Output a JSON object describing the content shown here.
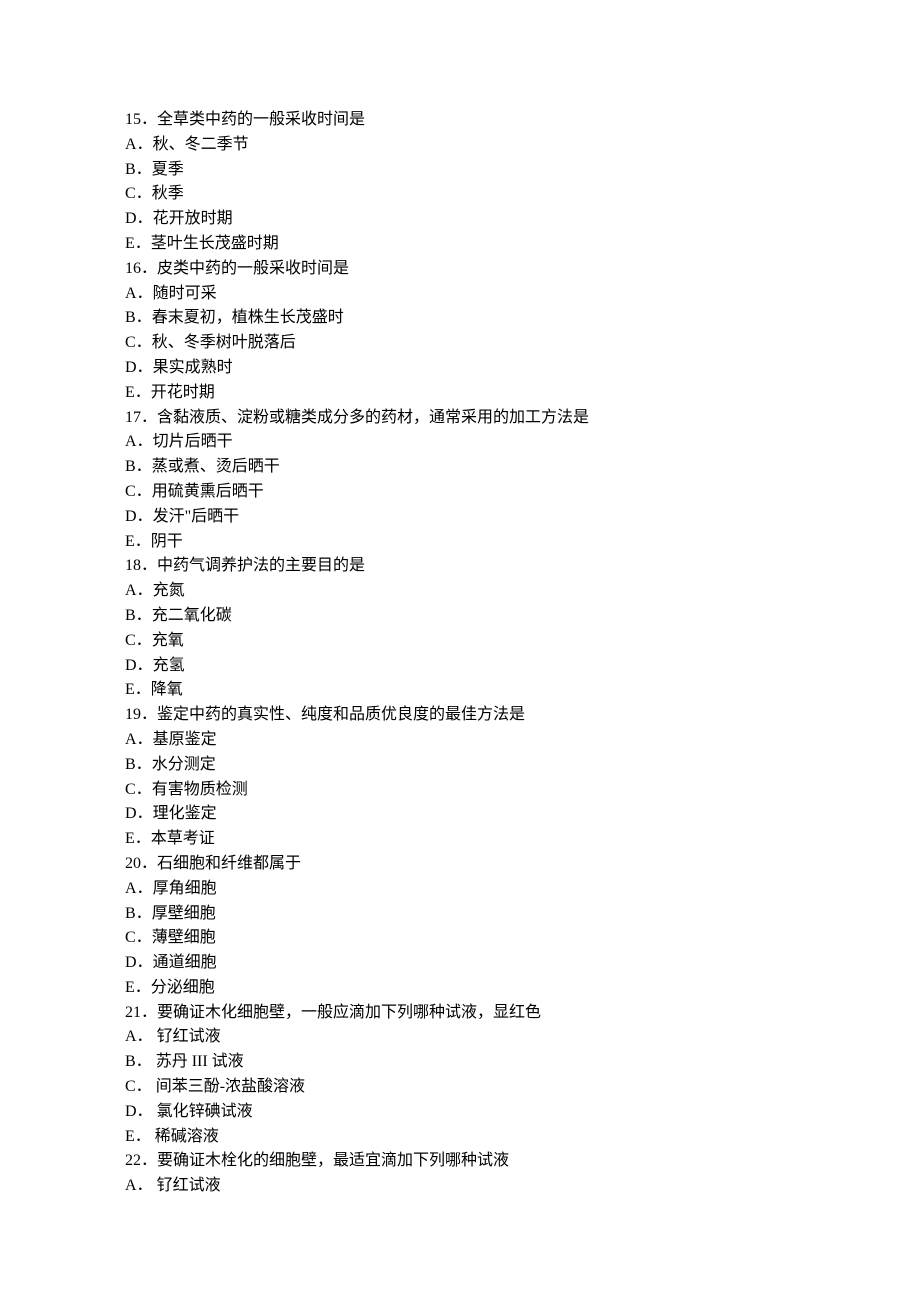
{
  "questions": [
    {
      "number": "15．",
      "stem": "全草类中药的一般采收时间是",
      "options": [
        {
          "letter": "A．",
          "text": "秋、冬二季节"
        },
        {
          "letter": "B．",
          "text": "夏季"
        },
        {
          "letter": "C．",
          "text": "秋季"
        },
        {
          "letter": "D．",
          "text": "花开放时期"
        },
        {
          "letter": "E．",
          "text": "茎叶生长茂盛时期"
        }
      ]
    },
    {
      "number": "16．",
      "stem": "皮类中药的一般采收时间是",
      "options": [
        {
          "letter": "A．",
          "text": "随时可采"
        },
        {
          "letter": "B．",
          "text": "春末夏初，植株生长茂盛时"
        },
        {
          "letter": "C．",
          "text": "秋、冬季树叶脱落后"
        },
        {
          "letter": "D．",
          "text": "果实成熟时"
        },
        {
          "letter": "E．",
          "text": "开花时期"
        }
      ]
    },
    {
      "number": "17．",
      "stem": "含黏液质、淀粉或糖类成分多的药材，通常采用的加工方法是",
      "options": [
        {
          "letter": "A．",
          "text": "切片后晒干"
        },
        {
          "letter": "B．",
          "text": "蒸或煮、烫后晒干"
        },
        {
          "letter": "C．",
          "text": "用硫黄熏后晒干"
        },
        {
          "letter": "D．",
          "text": "发汗\"后晒干"
        },
        {
          "letter": "E．",
          "text": "阴干"
        }
      ]
    },
    {
      "number": "18．",
      "stem": "中药气调养护法的主要目的是",
      "options": [
        {
          "letter": "A．",
          "text": "充氮"
        },
        {
          "letter": "B．",
          "text": "充二氧化碳"
        },
        {
          "letter": "C．",
          "text": "充氧"
        },
        {
          "letter": "D．",
          "text": "充氢"
        },
        {
          "letter": "E．",
          "text": "降氧"
        }
      ]
    },
    {
      "number": "19．",
      "stem": "鉴定中药的真实性、纯度和品质优良度的最佳方法是",
      "options": [
        {
          "letter": "A．",
          "text": "基原鉴定"
        },
        {
          "letter": "B．",
          "text": "水分测定"
        },
        {
          "letter": "C．",
          "text": "有害物质检测"
        },
        {
          "letter": "D．",
          "text": "理化鉴定"
        },
        {
          "letter": "E．",
          "text": "本草考证"
        }
      ]
    },
    {
      "number": "20．",
      "stem": "石细胞和纤维都属于",
      "options": [
        {
          "letter": "A．",
          "text": "厚角细胞"
        },
        {
          "letter": "B．",
          "text": "厚壁细胞"
        },
        {
          "letter": "C．",
          "text": "薄壁细胞"
        },
        {
          "letter": "D．",
          "text": "通道细胞"
        },
        {
          "letter": "E．",
          "text": "分泌细胞"
        }
      ]
    },
    {
      "number": "21．",
      "stem": "要确证木化细胞壁，一般应滴加下列哪种试液，显红色",
      "options": [
        {
          "letter": "A．  ",
          "text": "钌红试液"
        },
        {
          "letter": "B．  ",
          "text": "苏丹 III 试液"
        },
        {
          "letter": "C．  ",
          "text": "间苯三酚-浓盐酸溶液"
        },
        {
          "letter": "D．  ",
          "text": "氯化锌碘试液"
        },
        {
          "letter": "E．  ",
          "text": "稀碱溶液"
        }
      ]
    },
    {
      "number": "22．",
      "stem": "要确证木栓化的细胞壁，最适宜滴加下列哪种试液",
      "options": [
        {
          "letter": "A．  ",
          "text": "钌红试液"
        }
      ]
    }
  ]
}
